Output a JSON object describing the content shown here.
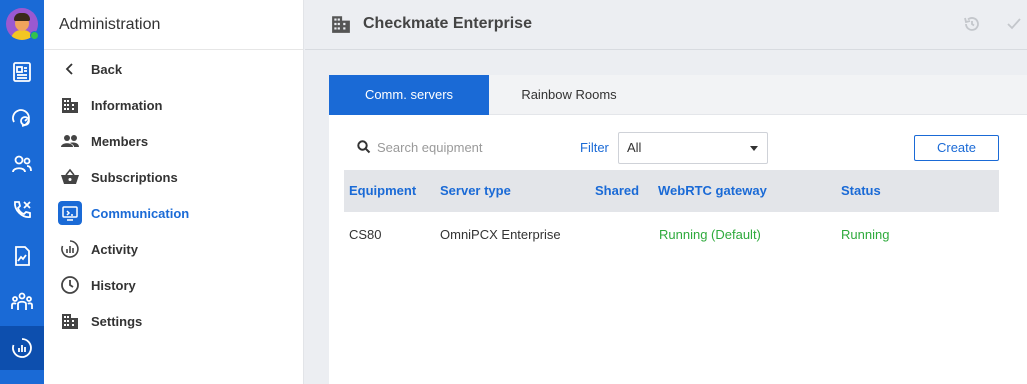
{
  "menu": {
    "title": "Administration",
    "items": [
      {
        "label": "Back",
        "icon": "chevron-left-icon"
      },
      {
        "label": "Information",
        "icon": "building-icon"
      },
      {
        "label": "Members",
        "icon": "members-icon"
      },
      {
        "label": "Subscriptions",
        "icon": "basket-icon"
      },
      {
        "label": "Communication",
        "icon": "communication-icon",
        "active": true
      },
      {
        "label": "Activity",
        "icon": "activity-icon"
      },
      {
        "label": "History",
        "icon": "clock-icon"
      },
      {
        "label": "Settings",
        "icon": "building-icon"
      }
    ]
  },
  "header": {
    "title": "Checkmate Enterprise",
    "icon": "building-icon"
  },
  "tabs": [
    {
      "label": "Comm. servers",
      "active": true
    },
    {
      "label": "Rainbow Rooms",
      "active": false
    }
  ],
  "toolbar": {
    "search_placeholder": "Search equipment",
    "filter_label": "Filter",
    "filter_value": "All",
    "create_label": "Create"
  },
  "table": {
    "headers": [
      "Equipment",
      "Server type",
      "Shared",
      "WebRTC gateway",
      "Status"
    ],
    "rows": [
      {
        "equipment": "CS80",
        "server_type": "OmniPCX Enterprise",
        "shared": "",
        "webrtc_gateway": "Running (Default)",
        "status": "Running"
      }
    ]
  },
  "colors": {
    "primary": "#1a6ad6",
    "rail_active": "#0d4fae",
    "success": "#2eaa3c",
    "table_header_bg": "#e3e5e9"
  }
}
